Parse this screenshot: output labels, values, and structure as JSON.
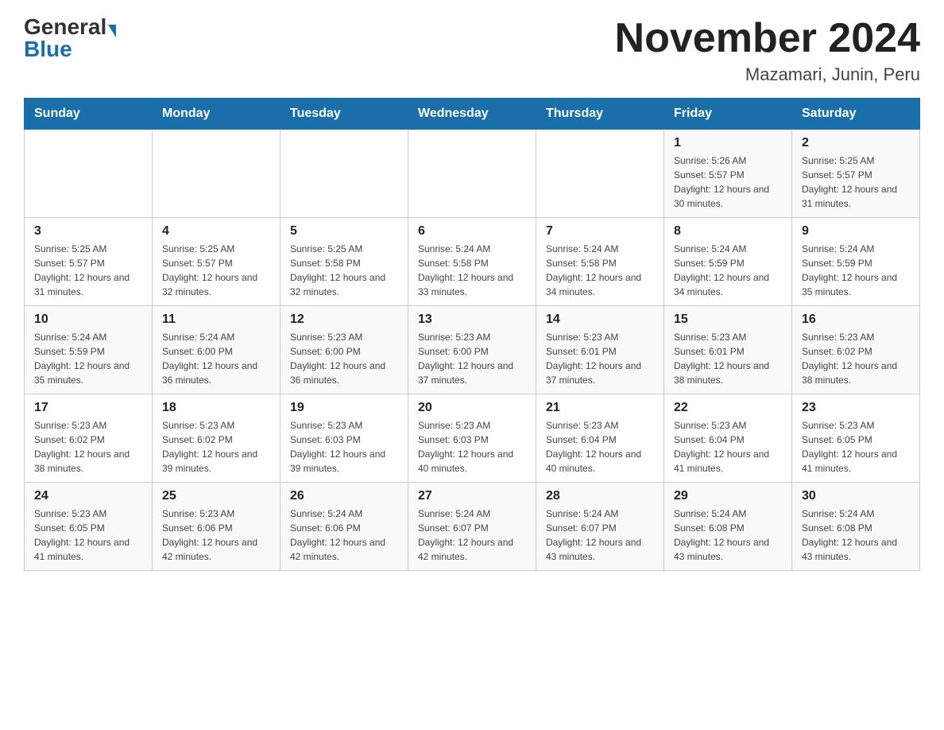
{
  "header": {
    "logo_general": "General",
    "logo_blue": "Blue",
    "month_title": "November 2024",
    "location": "Mazamari, Junin, Peru"
  },
  "weekdays": [
    "Sunday",
    "Monday",
    "Tuesday",
    "Wednesday",
    "Thursday",
    "Friday",
    "Saturday"
  ],
  "weeks": [
    [
      {
        "day": "",
        "sunrise": "",
        "sunset": "",
        "daylight": ""
      },
      {
        "day": "",
        "sunrise": "",
        "sunset": "",
        "daylight": ""
      },
      {
        "day": "",
        "sunrise": "",
        "sunset": "",
        "daylight": ""
      },
      {
        "day": "",
        "sunrise": "",
        "sunset": "",
        "daylight": ""
      },
      {
        "day": "",
        "sunrise": "",
        "sunset": "",
        "daylight": ""
      },
      {
        "day": "1",
        "sunrise": "Sunrise: 5:26 AM",
        "sunset": "Sunset: 5:57 PM",
        "daylight": "Daylight: 12 hours and 30 minutes."
      },
      {
        "day": "2",
        "sunrise": "Sunrise: 5:25 AM",
        "sunset": "Sunset: 5:57 PM",
        "daylight": "Daylight: 12 hours and 31 minutes."
      }
    ],
    [
      {
        "day": "3",
        "sunrise": "Sunrise: 5:25 AM",
        "sunset": "Sunset: 5:57 PM",
        "daylight": "Daylight: 12 hours and 31 minutes."
      },
      {
        "day": "4",
        "sunrise": "Sunrise: 5:25 AM",
        "sunset": "Sunset: 5:57 PM",
        "daylight": "Daylight: 12 hours and 32 minutes."
      },
      {
        "day": "5",
        "sunrise": "Sunrise: 5:25 AM",
        "sunset": "Sunset: 5:58 PM",
        "daylight": "Daylight: 12 hours and 32 minutes."
      },
      {
        "day": "6",
        "sunrise": "Sunrise: 5:24 AM",
        "sunset": "Sunset: 5:58 PM",
        "daylight": "Daylight: 12 hours and 33 minutes."
      },
      {
        "day": "7",
        "sunrise": "Sunrise: 5:24 AM",
        "sunset": "Sunset: 5:58 PM",
        "daylight": "Daylight: 12 hours and 34 minutes."
      },
      {
        "day": "8",
        "sunrise": "Sunrise: 5:24 AM",
        "sunset": "Sunset: 5:59 PM",
        "daylight": "Daylight: 12 hours and 34 minutes."
      },
      {
        "day": "9",
        "sunrise": "Sunrise: 5:24 AM",
        "sunset": "Sunset: 5:59 PM",
        "daylight": "Daylight: 12 hours and 35 minutes."
      }
    ],
    [
      {
        "day": "10",
        "sunrise": "Sunrise: 5:24 AM",
        "sunset": "Sunset: 5:59 PM",
        "daylight": "Daylight: 12 hours and 35 minutes."
      },
      {
        "day": "11",
        "sunrise": "Sunrise: 5:24 AM",
        "sunset": "Sunset: 6:00 PM",
        "daylight": "Daylight: 12 hours and 36 minutes."
      },
      {
        "day": "12",
        "sunrise": "Sunrise: 5:23 AM",
        "sunset": "Sunset: 6:00 PM",
        "daylight": "Daylight: 12 hours and 36 minutes."
      },
      {
        "day": "13",
        "sunrise": "Sunrise: 5:23 AM",
        "sunset": "Sunset: 6:00 PM",
        "daylight": "Daylight: 12 hours and 37 minutes."
      },
      {
        "day": "14",
        "sunrise": "Sunrise: 5:23 AM",
        "sunset": "Sunset: 6:01 PM",
        "daylight": "Daylight: 12 hours and 37 minutes."
      },
      {
        "day": "15",
        "sunrise": "Sunrise: 5:23 AM",
        "sunset": "Sunset: 6:01 PM",
        "daylight": "Daylight: 12 hours and 38 minutes."
      },
      {
        "day": "16",
        "sunrise": "Sunrise: 5:23 AM",
        "sunset": "Sunset: 6:02 PM",
        "daylight": "Daylight: 12 hours and 38 minutes."
      }
    ],
    [
      {
        "day": "17",
        "sunrise": "Sunrise: 5:23 AM",
        "sunset": "Sunset: 6:02 PM",
        "daylight": "Daylight: 12 hours and 38 minutes."
      },
      {
        "day": "18",
        "sunrise": "Sunrise: 5:23 AM",
        "sunset": "Sunset: 6:02 PM",
        "daylight": "Daylight: 12 hours and 39 minutes."
      },
      {
        "day": "19",
        "sunrise": "Sunrise: 5:23 AM",
        "sunset": "Sunset: 6:03 PM",
        "daylight": "Daylight: 12 hours and 39 minutes."
      },
      {
        "day": "20",
        "sunrise": "Sunrise: 5:23 AM",
        "sunset": "Sunset: 6:03 PM",
        "daylight": "Daylight: 12 hours and 40 minutes."
      },
      {
        "day": "21",
        "sunrise": "Sunrise: 5:23 AM",
        "sunset": "Sunset: 6:04 PM",
        "daylight": "Daylight: 12 hours and 40 minutes."
      },
      {
        "day": "22",
        "sunrise": "Sunrise: 5:23 AM",
        "sunset": "Sunset: 6:04 PM",
        "daylight": "Daylight: 12 hours and 41 minutes."
      },
      {
        "day": "23",
        "sunrise": "Sunrise: 5:23 AM",
        "sunset": "Sunset: 6:05 PM",
        "daylight": "Daylight: 12 hours and 41 minutes."
      }
    ],
    [
      {
        "day": "24",
        "sunrise": "Sunrise: 5:23 AM",
        "sunset": "Sunset: 6:05 PM",
        "daylight": "Daylight: 12 hours and 41 minutes."
      },
      {
        "day": "25",
        "sunrise": "Sunrise: 5:23 AM",
        "sunset": "Sunset: 6:06 PM",
        "daylight": "Daylight: 12 hours and 42 minutes."
      },
      {
        "day": "26",
        "sunrise": "Sunrise: 5:24 AM",
        "sunset": "Sunset: 6:06 PM",
        "daylight": "Daylight: 12 hours and 42 minutes."
      },
      {
        "day": "27",
        "sunrise": "Sunrise: 5:24 AM",
        "sunset": "Sunset: 6:07 PM",
        "daylight": "Daylight: 12 hours and 42 minutes."
      },
      {
        "day": "28",
        "sunrise": "Sunrise: 5:24 AM",
        "sunset": "Sunset: 6:07 PM",
        "daylight": "Daylight: 12 hours and 43 minutes."
      },
      {
        "day": "29",
        "sunrise": "Sunrise: 5:24 AM",
        "sunset": "Sunset: 6:08 PM",
        "daylight": "Daylight: 12 hours and 43 minutes."
      },
      {
        "day": "30",
        "sunrise": "Sunrise: 5:24 AM",
        "sunset": "Sunset: 6:08 PM",
        "daylight": "Daylight: 12 hours and 43 minutes."
      }
    ]
  ]
}
